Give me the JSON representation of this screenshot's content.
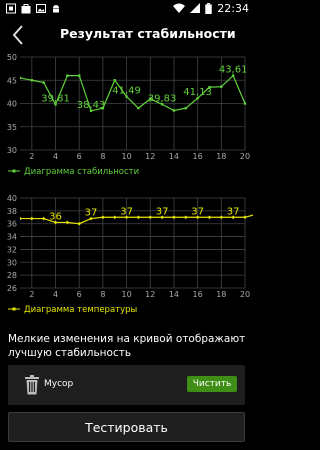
{
  "status_bar": {
    "time": "22:34",
    "left_icons": [
      "screenshot-icon",
      "bag-icon",
      "image-icon",
      "android-icon"
    ],
    "right_icons": [
      "wifi-icon",
      "signal-icon",
      "battery-icon"
    ]
  },
  "header": {
    "title": "Результат стабильности"
  },
  "chart_data": [
    {
      "type": "line",
      "legend": "Диаграмма стабильности",
      "color": "#5fd13a",
      "ylim": [
        30,
        50
      ],
      "yticks": [
        30,
        35,
        40,
        45,
        50
      ],
      "xlim": [
        1,
        20
      ],
      "xticks": [
        2,
        4,
        6,
        8,
        10,
        12,
        14,
        16,
        18,
        20
      ],
      "x": [
        1,
        2,
        3,
        4,
        5,
        6,
        7,
        8,
        9,
        10,
        11,
        12,
        13,
        14,
        15,
        16,
        17,
        18,
        19,
        20
      ],
      "y": [
        45.5,
        45,
        44.5,
        39.81,
        46,
        46,
        38.43,
        39,
        45,
        41.49,
        39,
        41,
        39.83,
        38.5,
        39,
        41.13,
        43.5,
        43.61,
        46,
        40
      ],
      "labels": [
        {
          "x": 4,
          "text": "39,81"
        },
        {
          "x": 7,
          "text": "38,43"
        },
        {
          "x": 10,
          "text": "41,49"
        },
        {
          "x": 13,
          "text": "39,83"
        },
        {
          "x": 16,
          "text": "41,13"
        },
        {
          "x": 19,
          "text": "43,61"
        }
      ]
    },
    {
      "type": "line",
      "legend": "Диаграмма температуры",
      "color": "#e6e600",
      "ylim": [
        26,
        40
      ],
      "yticks": [
        26,
        28,
        30,
        32,
        34,
        36,
        38,
        40
      ],
      "xlim": [
        1,
        20
      ],
      "xticks": [
        2,
        4,
        6,
        8,
        10,
        12,
        14,
        16,
        18,
        20
      ],
      "x": [
        1,
        2,
        3,
        4,
        5,
        6,
        7,
        8,
        9,
        10,
        11,
        12,
        13,
        14,
        15,
        16,
        17,
        18,
        19,
        20,
        21
      ],
      "y": [
        36.8,
        36.8,
        36.8,
        36.2,
        36.2,
        36,
        36.8,
        37,
        37,
        37,
        37,
        37,
        37,
        37,
        37,
        37,
        37,
        37,
        37,
        37,
        37.5
      ],
      "labels": [
        {
          "x": 4,
          "text": "36"
        },
        {
          "x": 7,
          "text": "37"
        },
        {
          "x": 10,
          "text": "37"
        },
        {
          "x": 13,
          "text": "37"
        },
        {
          "x": 16,
          "text": "37"
        },
        {
          "x": 19,
          "text": "37"
        }
      ]
    }
  ],
  "description": "Мелкие изменения на кривой отображают лучшую стабильность",
  "trash": {
    "label": "Мусор",
    "button_label": "Чистить"
  },
  "test_button_label": "Тестировать"
}
